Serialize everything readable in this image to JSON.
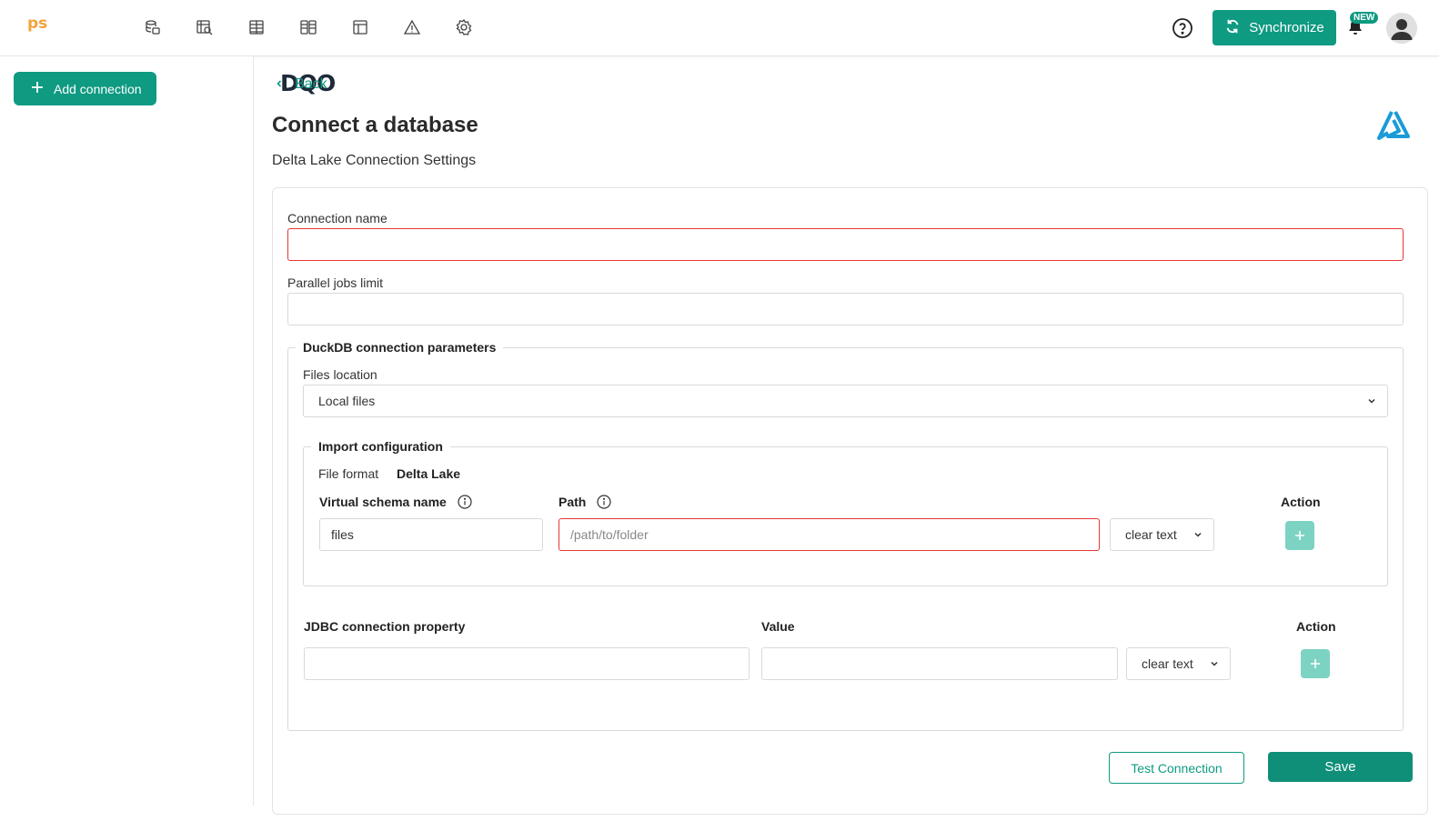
{
  "header": {
    "logo_main": "DQO",
    "logo_suffix": "ps",
    "nav_icons": [
      "data-sources-icon",
      "profiling-icon",
      "monitoring-checks-icon",
      "partition-checks-icon",
      "data-quality-dashboards-icon",
      "incidents-icon",
      "configuration-icon"
    ],
    "sync_label": "Synchronize",
    "new_badge": "NEW",
    "brand_color": "#0f9a82"
  },
  "sidebar": {
    "add_connection_label": "Add connection"
  },
  "main": {
    "back_label": "Back",
    "title": "Connect a database",
    "subtitle": "Delta Lake Connection Settings",
    "form": {
      "connection_name_label": "Connection name",
      "connection_name_value": "",
      "parallel_jobs_label": "Parallel jobs limit",
      "parallel_jobs_value": "",
      "duckdb_legend": "DuckDB connection parameters",
      "files_location_label": "Files location",
      "files_location_value": "Local files",
      "import_legend": "Import configuration",
      "file_format_label": "File format",
      "file_format_value": "Delta Lake",
      "virtual_schema_header": "Virtual schema name",
      "path_header": "Path",
      "action_header": "Action",
      "virtual_schema_value": "files",
      "path_placeholder": "/path/to/folder",
      "path_mode": "clear text",
      "jdbc_property_header": "JDBC connection property",
      "jdbc_value_header": "Value",
      "jdbc_action_header": "Action",
      "jdbc_mode": "clear text"
    },
    "test_connection_label": "Test Connection",
    "save_label": "Save"
  }
}
